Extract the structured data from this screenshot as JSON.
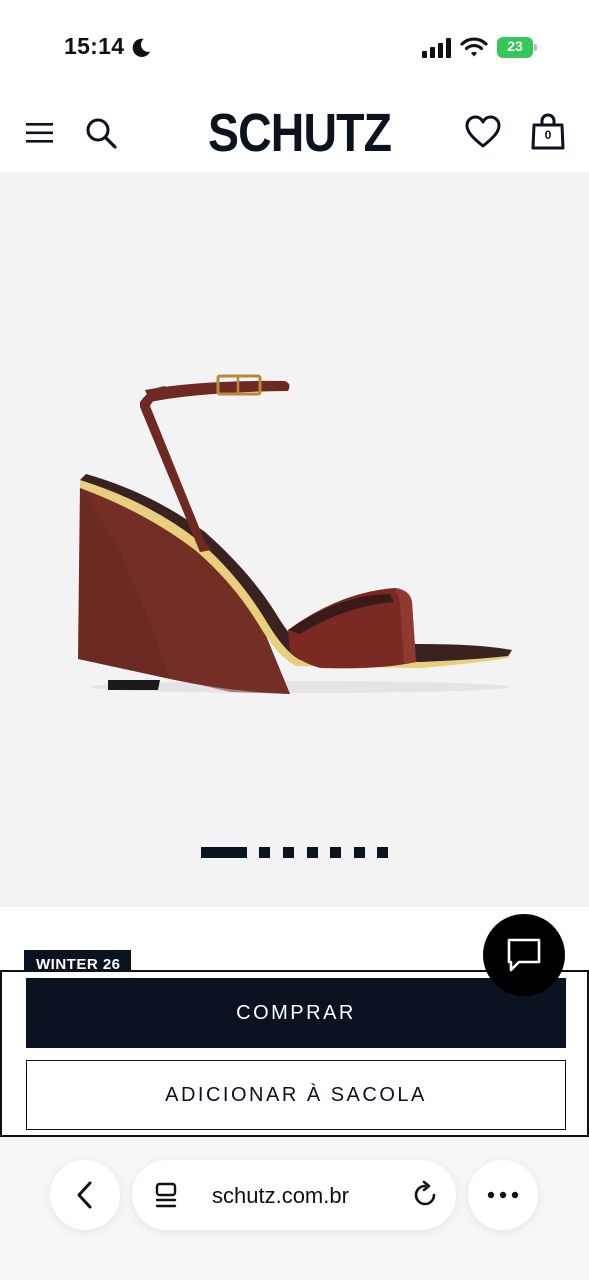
{
  "status_bar": {
    "time": "15:14",
    "battery": "23"
  },
  "header": {
    "brand": "SCHUTZ",
    "bag_count": "0"
  },
  "gallery": {
    "active_index": 0,
    "total": 8
  },
  "product": {
    "collection_badge": "WINTER 26"
  },
  "actions": {
    "buy_label": "COMPRAR",
    "add_to_bag_label": "ADICIONAR À SACOLA"
  },
  "browser": {
    "url": "schutz.com.br"
  },
  "icons": {
    "menu": "menu-icon",
    "search": "search-icon",
    "wishlist": "heart-icon",
    "bag": "bag-icon",
    "chat": "chat-icon",
    "back": "chevron-left-icon",
    "tabs": "tabs-icon",
    "reload": "reload-icon",
    "more": "more-icon"
  },
  "colors": {
    "brand_navy": "#0b1220",
    "gallery_bg": "#f3f3f4",
    "product_burgundy": "#6e2a22",
    "battery_green": "#34c759"
  }
}
